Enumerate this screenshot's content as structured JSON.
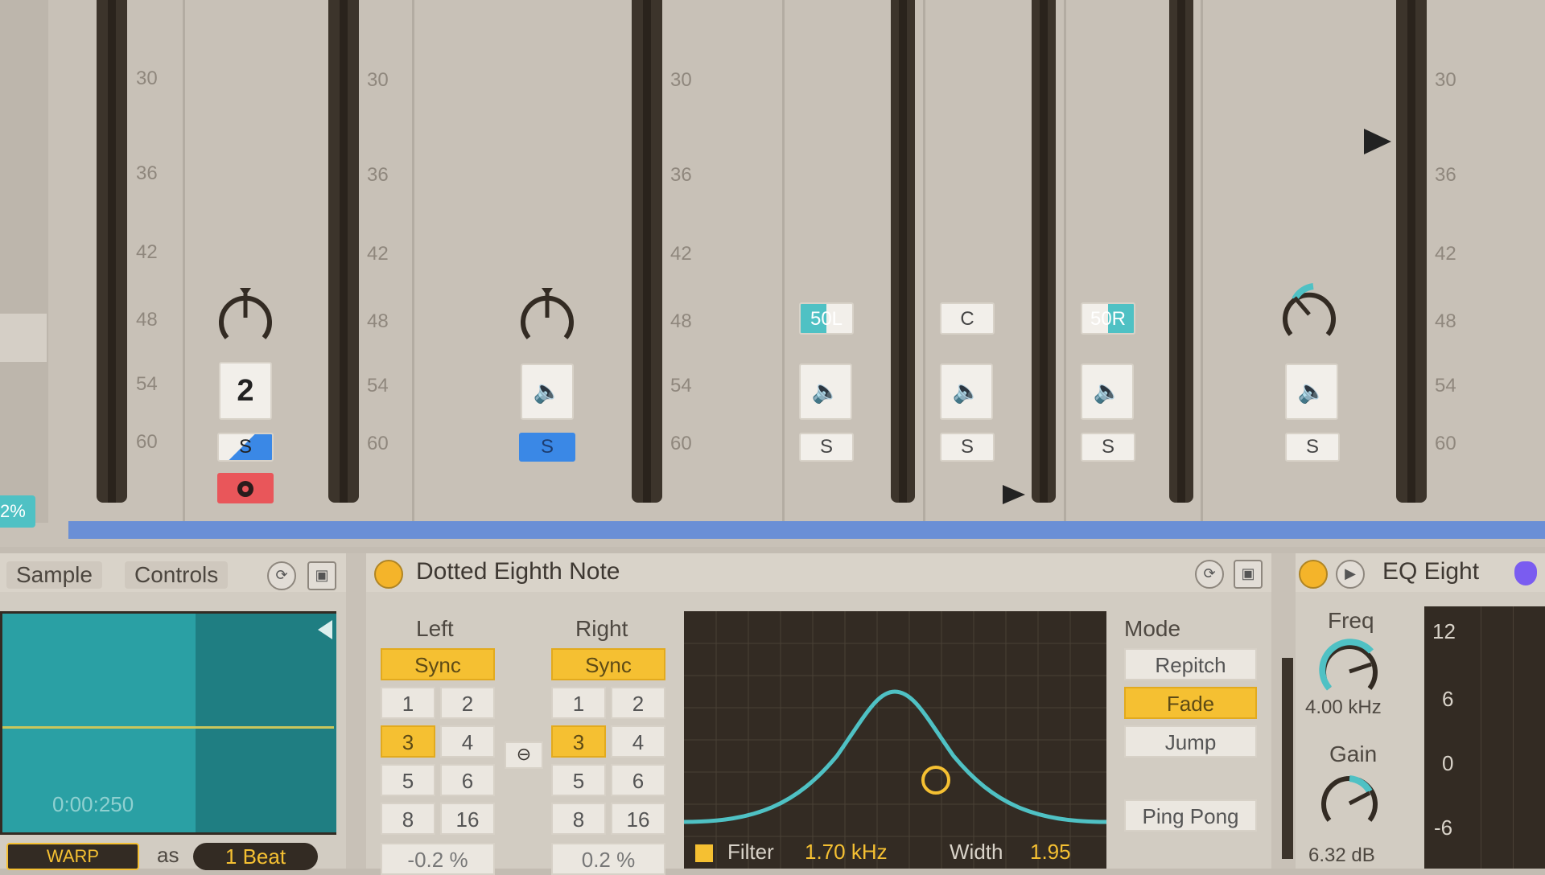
{
  "mixer": {
    "scale": [
      "30",
      "36",
      "42",
      "48",
      "54",
      "60"
    ],
    "tracks": [
      {
        "id": "t1",
        "number": "2",
        "solo": "S",
        "pan_mode": "knob",
        "solo_state": "half",
        "arm": true
      },
      {
        "id": "t2",
        "speaker": "🔈",
        "solo": "S",
        "pan_mode": "knob",
        "solo_state": "on"
      },
      {
        "id": "t3",
        "pan_label": "50L",
        "speaker": "🔈",
        "solo": "S",
        "solo_state": "off"
      },
      {
        "id": "t4",
        "pan_label": "C",
        "speaker": "🔈",
        "solo": "S",
        "solo_state": "off"
      },
      {
        "id": "t5",
        "pan_label": "50R",
        "speaker": "🔈",
        "solo": "S",
        "solo_state": "off"
      },
      {
        "id": "t6",
        "speaker": "🔈",
        "solo": "S",
        "pan_mode": "cyan-knob",
        "solo_state": "off"
      }
    ],
    "left_edge_value": "2%"
  },
  "sampler": {
    "tabs": [
      "Sample",
      "Controls"
    ],
    "time": "0:00:250",
    "warp": "WARP",
    "as_label": "as",
    "beat": "1 Beat"
  },
  "delay": {
    "title": "Dotted Eighth Note",
    "left_label": "Left",
    "right_label": "Right",
    "sync": "Sync",
    "grid": [
      "1",
      "2",
      "3",
      "4",
      "5",
      "6",
      "8",
      "16"
    ],
    "selected": "3",
    "left_offset": "-0.2 %",
    "right_offset": "0.2 %",
    "link_icon": "link-icon",
    "mode_label": "Mode",
    "modes": [
      "Repitch",
      "Fade",
      "Jump"
    ],
    "active_mode": "Fade",
    "ping_pong": "Ping Pong",
    "filter_label": "Filter",
    "filter_value": "1.70 kHz",
    "width_label": "Width",
    "width_value": "1.95"
  },
  "eq": {
    "title": "EQ Eight",
    "freq_label": "Freq",
    "freq_value": "4.00 kHz",
    "gain_label": "Gain",
    "gain_value": "6.32 dB",
    "scale": [
      "12",
      "6",
      "0",
      "-6"
    ]
  },
  "colors": {
    "accent_yellow": "#f5c032",
    "cyan": "#4fc1c4",
    "blue": "#3a88e6",
    "arm_red": "#e9565a"
  }
}
